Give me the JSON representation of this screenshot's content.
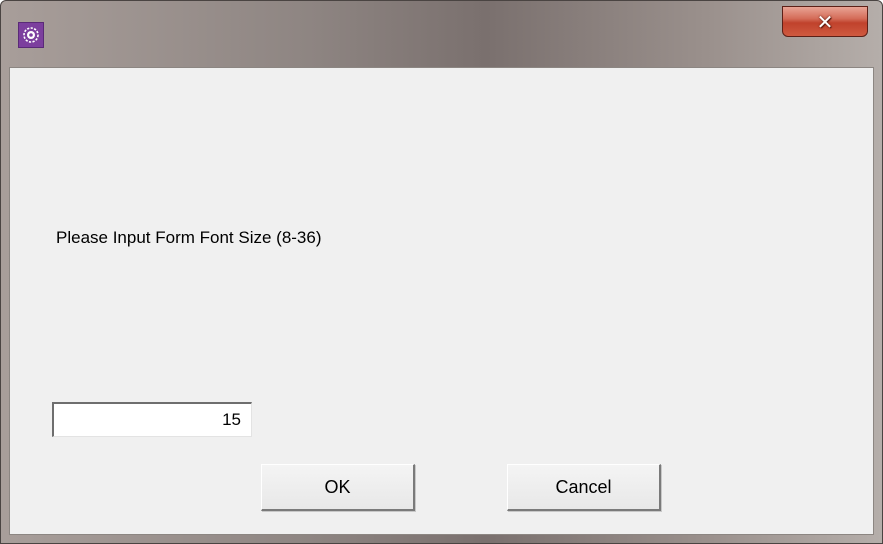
{
  "window": {
    "title": "",
    "app_icon": "app-gear-icon",
    "close_icon": "close-icon",
    "close_glyph": "✕"
  },
  "dialog": {
    "prompt": "Please Input Form Font Size (8-36)",
    "font_size_value": "15",
    "ok_label": "OK",
    "cancel_label": "Cancel"
  },
  "colors": {
    "close_button": "#c7432e",
    "client_background": "#f0f0f0",
    "app_icon_background": "#7c3f9e"
  }
}
